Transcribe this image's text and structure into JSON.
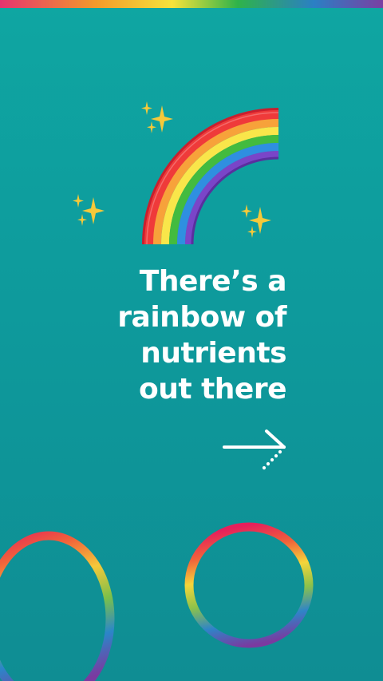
{
  "slide": {
    "headline_lines": [
      "There’s a",
      "rainbow of",
      "nutrients",
      "out there"
    ]
  },
  "decorations": {
    "rainbow": "rainbow-emoji",
    "sparkles": "sparkles-emoji",
    "rings": "rainbow-rings"
  },
  "navigation": {
    "next_icon": "arrow-right-icon"
  },
  "colors": {
    "background": "#0e9a9c",
    "text": "#ffffff",
    "rainbow": [
      "#e62d4a",
      "#f39a2b",
      "#f6e33b",
      "#34b24a",
      "#2b7fc4",
      "#7b3fa2"
    ]
  }
}
